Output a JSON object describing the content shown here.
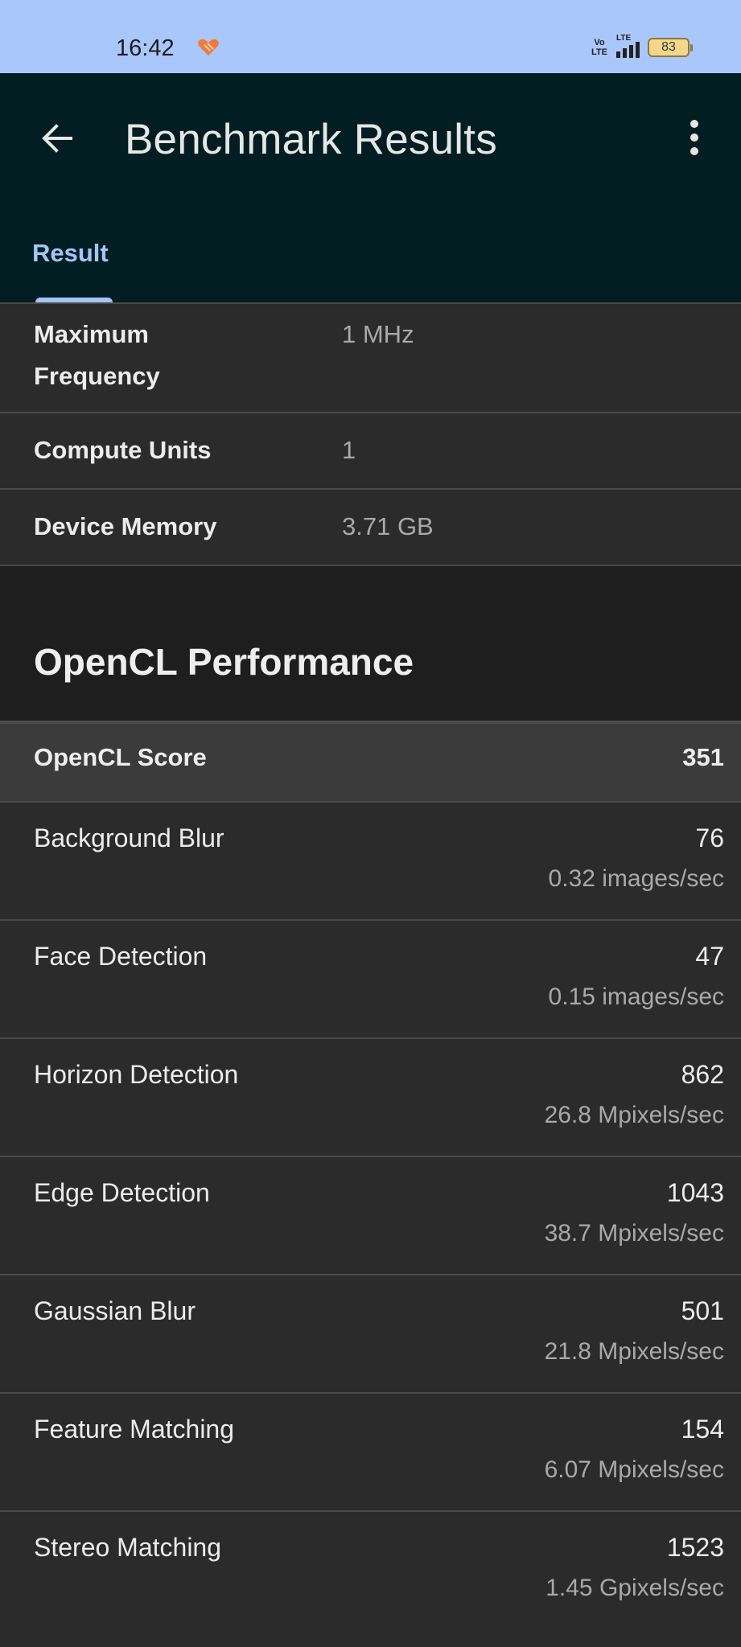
{
  "status_bar": {
    "time": "16:42",
    "volte": "Vo LTE",
    "network": "LTE",
    "battery": "83"
  },
  "app_bar": {
    "title": "Benchmark Results",
    "tabs": [
      {
        "label": "Result",
        "selected": true
      }
    ]
  },
  "device_info": [
    {
      "label": "Maximum Frequency",
      "value": "1 MHz"
    },
    {
      "label": "Compute Units",
      "value": "1"
    },
    {
      "label": "Device Memory",
      "value": "3.71 GB"
    }
  ],
  "section": {
    "title": "OpenCL Performance",
    "score_label": "OpenCL Score",
    "score_value": "351"
  },
  "benchmarks": [
    {
      "name": "Background Blur",
      "score": "76",
      "rate": "0.32 images/sec"
    },
    {
      "name": "Face Detection",
      "score": "47",
      "rate": "0.15 images/sec"
    },
    {
      "name": "Horizon Detection",
      "score": "862",
      "rate": "26.8 Mpixels/sec"
    },
    {
      "name": "Edge Detection",
      "score": "1043",
      "rate": "38.7 Mpixels/sec"
    },
    {
      "name": "Gaussian Blur",
      "score": "501",
      "rate": "21.8 Mpixels/sec"
    },
    {
      "name": "Feature Matching",
      "score": "154",
      "rate": "6.07 Mpixels/sec"
    },
    {
      "name": "Stereo Matching",
      "score": "1523",
      "rate": "1.45 Gpixels/sec"
    }
  ],
  "colors": {
    "status_bar_bg": "#a9c7fb",
    "app_bar_bg": "#031e22",
    "accent": "#a4c5f5",
    "row_bg": "#2b2b2b",
    "score_row_bg": "#3b3b3b"
  },
  "icons": [
    "back-arrow-icon",
    "more-vert-icon",
    "heart-icon",
    "signal-icon",
    "battery-icon"
  ]
}
